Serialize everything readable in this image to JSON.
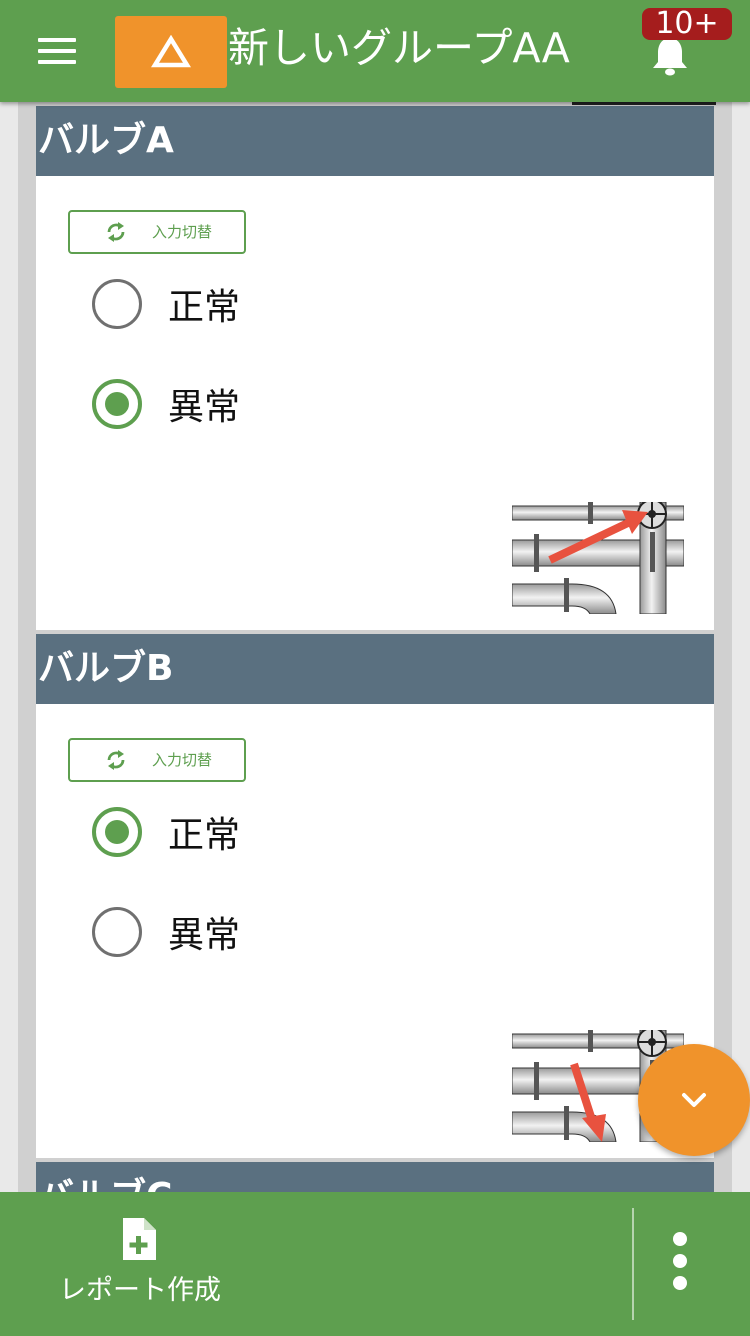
{
  "header": {
    "title": "新しいグループAA",
    "notification_badge": "10+"
  },
  "sections": [
    {
      "name": "バルブA",
      "switch_label": "入力切替",
      "options": [
        "正常",
        "異常"
      ],
      "selected": "異常"
    },
    {
      "name": "バルブB",
      "switch_label": "入力切替",
      "options": [
        "正常",
        "異常"
      ],
      "selected": "正常"
    },
    {
      "name": "バルブC"
    }
  ],
  "footer": {
    "report_label": "レポート作成"
  },
  "colors": {
    "primary_green": "#5e9f4f",
    "accent_orange": "#f0932b",
    "section_header": "#5a7080",
    "badge_red": "#a51d1d"
  }
}
